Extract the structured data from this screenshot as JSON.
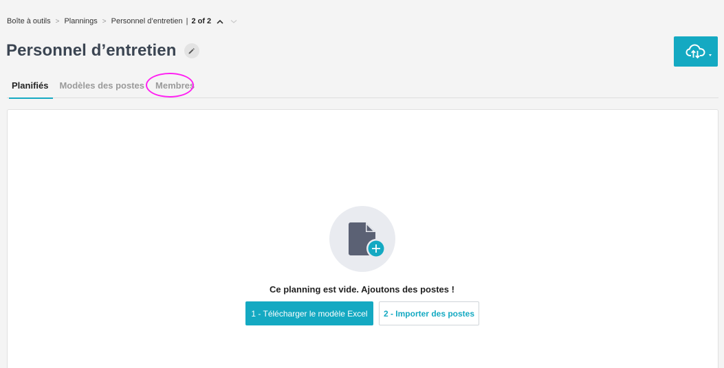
{
  "breadcrumb": {
    "items": [
      "Boîte à outils",
      "Plannings",
      "Personnel d’entretien"
    ],
    "separator": ">",
    "pager": "2 of 2"
  },
  "page": {
    "title": "Personnel d’entretien"
  },
  "header_actions": {
    "cloud_button_icon": "cloud-upload-download-icon",
    "accent_color": "#14a9c2"
  },
  "tabs": [
    {
      "label": "Planifiés",
      "active": true
    },
    {
      "label": "Modèles des postes",
      "active": false
    },
    {
      "label": "Membres",
      "active": false,
      "highlighted": true
    }
  ],
  "empty_state": {
    "icon": "new-document-icon",
    "message": "Ce planning est vide. Ajoutons des postes !",
    "primary_button": "1 - Télécharger le modèle Excel",
    "secondary_button": "2 - Importer des postes"
  },
  "colors": {
    "accent": "#14a9c2",
    "highlight_ring": "#ff1ff2",
    "title": "#3b4552"
  }
}
